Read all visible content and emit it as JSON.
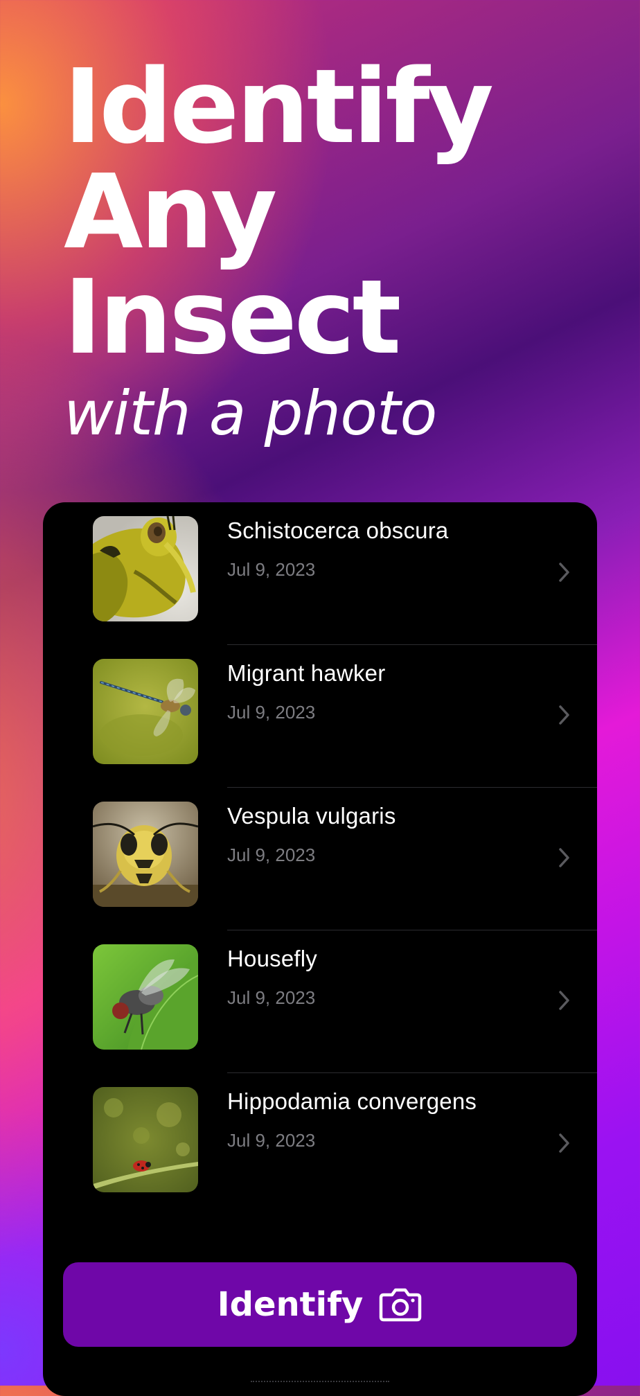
{
  "hero": {
    "line1": "Identify",
    "line2": "Any",
    "line3": "Insect",
    "subtitle": "with a photo"
  },
  "history": {
    "items": [
      {
        "title": "Schistocerca obscura",
        "date": "Jul 9, 2023",
        "icon": "chevron-right-icon"
      },
      {
        "title": "Migrant hawker",
        "date": "Jul 9, 2023",
        "icon": "chevron-right-icon"
      },
      {
        "title": "Vespula vulgaris",
        "date": "Jul 9, 2023",
        "icon": "chevron-right-icon"
      },
      {
        "title": "Housefly",
        "date": "Jul 9, 2023",
        "icon": "chevron-right-icon"
      },
      {
        "title": "Hippodamia convergens",
        "date": "Jul 9, 2023",
        "icon": "chevron-right-icon"
      }
    ]
  },
  "action": {
    "label": "Identify",
    "icon": "camera-icon",
    "color": "#6f07a8"
  }
}
